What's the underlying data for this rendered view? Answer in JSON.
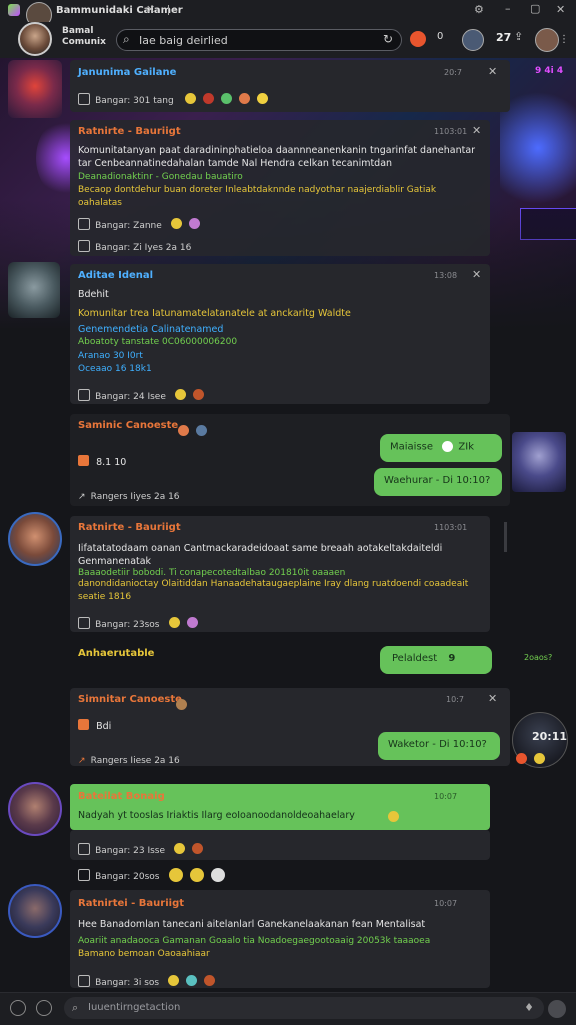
{
  "window": {
    "title": "Bammunidaki Calamer",
    "header_line1": "Bamal",
    "header_line2": "Comunix"
  },
  "search": {
    "value": "Iae baig deirlied"
  },
  "header": {
    "notif_count": "0",
    "counter": "27"
  },
  "cards": [
    {
      "name": "Janunima Gailane",
      "time": "20:7",
      "meta": "Bangar: 301 tang",
      "name_color": "#4fb0ff"
    },
    {
      "name": "Ratnirte - Bauriigt",
      "time": "1103:01",
      "text_white": "Komunitatanyan paat daradininphatieloa daannneanenkanin tngarinfat danehantar tar Cenbeannatinedahalan tamde Nal Hendra celkan tecanimtdan",
      "text_green": "Deanadionaktinr - Gonedau bauatiro",
      "text_yellow": "Becaop dontdehur buan doreter Inleabtdaknnde nadyothar naajerdiablir Gatiak oahalatas",
      "meta": "Bangar: Zanne",
      "meta2": "Bangar: Zi Iyes 2a 16",
      "name_color": "#e8763a"
    },
    {
      "name": "Aditae Idenal",
      "time": "13:08",
      "sub": "Bdehit",
      "text_yellow": "Komunitar trea Iatunamatelatanatele at anckaritg Waldte",
      "text_blue": "Genemendetia Calinatenamed",
      "text_green": "Aboatoty tanstate 0C06000006200",
      "line4": "Aranao 30 I0rt",
      "line5": "Oceaao 16 18k1",
      "meta": "Bangar: 24 Isee",
      "name_color": "#4fb0ff"
    },
    {
      "name": "Saminic Canoeste",
      "sub": "8.1 10",
      "meta": "Rangers Iiyes 2a 16",
      "name_color": "#e8763a"
    },
    {
      "name": "Ratnirte - Bauriigt",
      "time": "1103:01",
      "text_white": "Iifatatatodaam oanan Cantmackaradeidoaat same breaah aotakeltakdaiteldi Genmanenatak",
      "text_green": "Baaaodetiir bobodi. Ti conapecotedtalbao 201810it oaaaen",
      "text_yellow": "danondidanioctay Olaitiddan Hanaadehataugaeplaine Iray dlang ruatdoendi coaadeait seatie 1816",
      "meta": "Bangar: 23sos",
      "name_color": "#e8763a"
    },
    {
      "name": "Simnitar Canoeste",
      "time": "10:7",
      "sub": "Bdi",
      "meta": "Rangers Iiese 2a 16",
      "name_color": "#e8763a"
    },
    {
      "name": "Bateilat Bonaig",
      "time": "10:07",
      "text_dark": "Nadyah yt tooslas Iriaktis Ilarg eoIoanoodanoldeoahaelary",
      "meta": "Bangar: 23 Isse",
      "name_color": "#e8763a"
    },
    {
      "meta": "Bangar: 20sos"
    },
    {
      "name": "Ratnirtei - Bauriigt",
      "time": "10:07",
      "text_white": "Hee Banadomlan tanecani aitelanlarl Ganekanelaakanan fean Mentalisat",
      "text_green": "Aoariit anadaooca Gamanan Goaalo tia Noadoegaegootoaaig 20053k taaaoea",
      "text_yellow": "Bamano bemoan Oaoaahiaar",
      "meta": "Bangar: 3i sos",
      "name_color": "#e8763a"
    }
  ],
  "left_labels": {
    "actionable": "Anhaerutable"
  },
  "bubbles": [
    {
      "text": "Maiaisse",
      "suffix": "ZIk"
    },
    {
      "text": "Waehurar - Di 10:10?"
    },
    {
      "text": "Pelaldest",
      "suffix": "9"
    },
    {
      "text": "Waketor - Di 10:10?"
    }
  ],
  "right_labels": {
    "top_right": "9 4i 4",
    "green_small": "2oaos?",
    "avatar_time": "20:11"
  },
  "composer": {
    "placeholder": "Iuuentirngetaction"
  },
  "colors": {
    "bg": "#15161a",
    "card": "#26272c",
    "green": "#66c25a",
    "blue_name": "#4fb0ff",
    "orange_name": "#e8763a",
    "yellow_text": "#e6c63a",
    "green_text": "#72d04f",
    "blue_text": "#3fb0ff"
  }
}
